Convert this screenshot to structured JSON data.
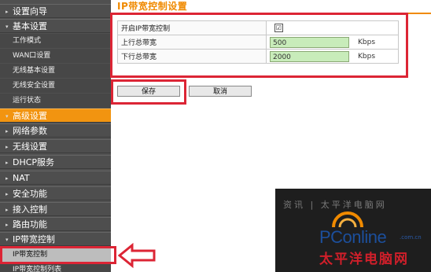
{
  "sidebar": {
    "items": [
      {
        "label": "设置向导",
        "type": "main"
      },
      {
        "label": "基本设置",
        "type": "main-open"
      },
      {
        "label": "工作模式",
        "type": "sub"
      },
      {
        "label": "WAN口设置",
        "type": "sub"
      },
      {
        "label": "无线基本设置",
        "type": "sub"
      },
      {
        "label": "无线安全设置",
        "type": "sub"
      },
      {
        "label": "运行状态",
        "type": "sub"
      },
      {
        "label": "高级设置",
        "type": "main-active"
      },
      {
        "label": "网络参数",
        "type": "main"
      },
      {
        "label": "无线设置",
        "type": "main"
      },
      {
        "label": "DHCP服务",
        "type": "main"
      },
      {
        "label": "NAT",
        "type": "main"
      },
      {
        "label": "安全功能",
        "type": "main"
      },
      {
        "label": "接入控制",
        "type": "main"
      },
      {
        "label": "路由功能",
        "type": "main"
      },
      {
        "label": "IP带宽控制",
        "type": "main-open"
      },
      {
        "label": "IP带宽控制",
        "type": "sub-selected"
      },
      {
        "label": "IP带宽控制列表",
        "type": "sub"
      }
    ]
  },
  "main": {
    "title": "IP带宽控制设置",
    "rows": [
      {
        "label": "开启IP带宽控制",
        "checked": true,
        "check_mark": "☑"
      },
      {
        "label": "上行总带宽",
        "value": "500",
        "unit": "Kbps"
      },
      {
        "label": "下行总带宽",
        "value": "2000",
        "unit": "Kbps"
      }
    ],
    "save_label": "保存",
    "cancel_label": "取消"
  },
  "overlay_text": "资讯 | 太平洋电脑网",
  "watermark": {
    "brand": "PConline",
    "domain": ".com.cn",
    "cn_name": "太平洋电脑网"
  },
  "colors": {
    "accent": "#f08a00",
    "highlight": "#dc2535",
    "sidebar_bg": "#505050"
  },
  "icons": [
    "expand-arrow-icon",
    "collapse-arrow-icon",
    "checkbox-icon",
    "left-pointing-arrow-icon",
    "pconline-logo-icon"
  ]
}
